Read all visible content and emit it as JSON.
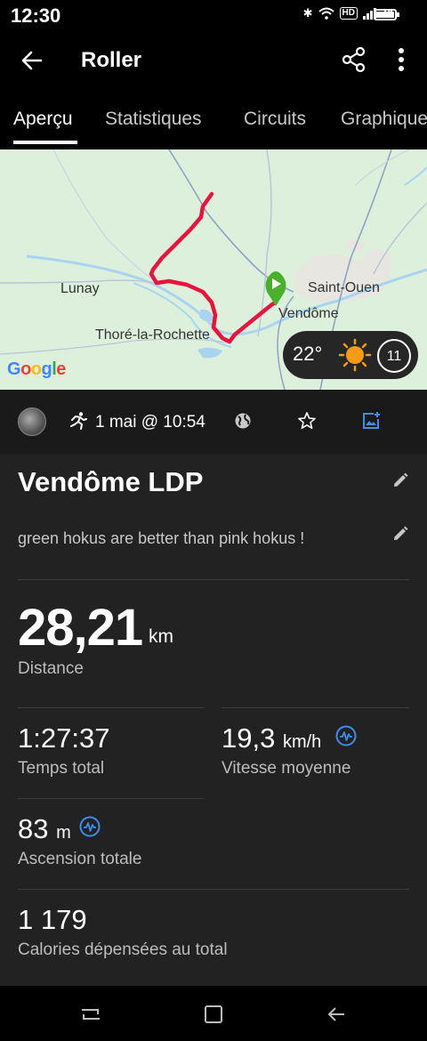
{
  "status_bar": {
    "time": "12:30",
    "hd": "HD",
    "network": "4G"
  },
  "app_bar": {
    "title": "Roller"
  },
  "tabs": [
    {
      "label": "Aperçu",
      "active": true
    },
    {
      "label": "Statistiques",
      "active": false
    },
    {
      "label": "Circuits",
      "active": false
    },
    {
      "label": "Graphiques",
      "active": false
    }
  ],
  "map": {
    "labels": {
      "lunay": "Lunay",
      "saint_ouen": "Saint-Ouen",
      "vendome": "Vendôme",
      "thore": "Thoré-la-Rochette"
    },
    "google": [
      "G",
      "o",
      "o",
      "g",
      "l",
      "e"
    ],
    "google_colors": [
      "#4285F4",
      "#EA4335",
      "#FBBC05",
      "#4285F4",
      "#34A853",
      "#EA4335"
    ],
    "route_color": "#e8133f",
    "weather": {
      "temp": "22°",
      "uv": "11"
    }
  },
  "activity": {
    "date": "1 mai @ 10:54",
    "title": "Vendôme LDP",
    "description": "green hokus are better than pink hokus !"
  },
  "stats": {
    "distance": {
      "value": "28,21",
      "unit": "km",
      "label": "Distance"
    },
    "time": {
      "value": "1:27:37",
      "label": "Temps total"
    },
    "speed": {
      "value": "19,3",
      "unit": "km/h",
      "label": "Vitesse moyenne"
    },
    "ascent": {
      "value": "83",
      "unit": "m",
      "label": "Ascension totale"
    },
    "calories": {
      "value": "1 179",
      "label": "Calories dépensées au total"
    }
  },
  "colors": {
    "accent": "#3d8eea",
    "background": "#222222"
  }
}
